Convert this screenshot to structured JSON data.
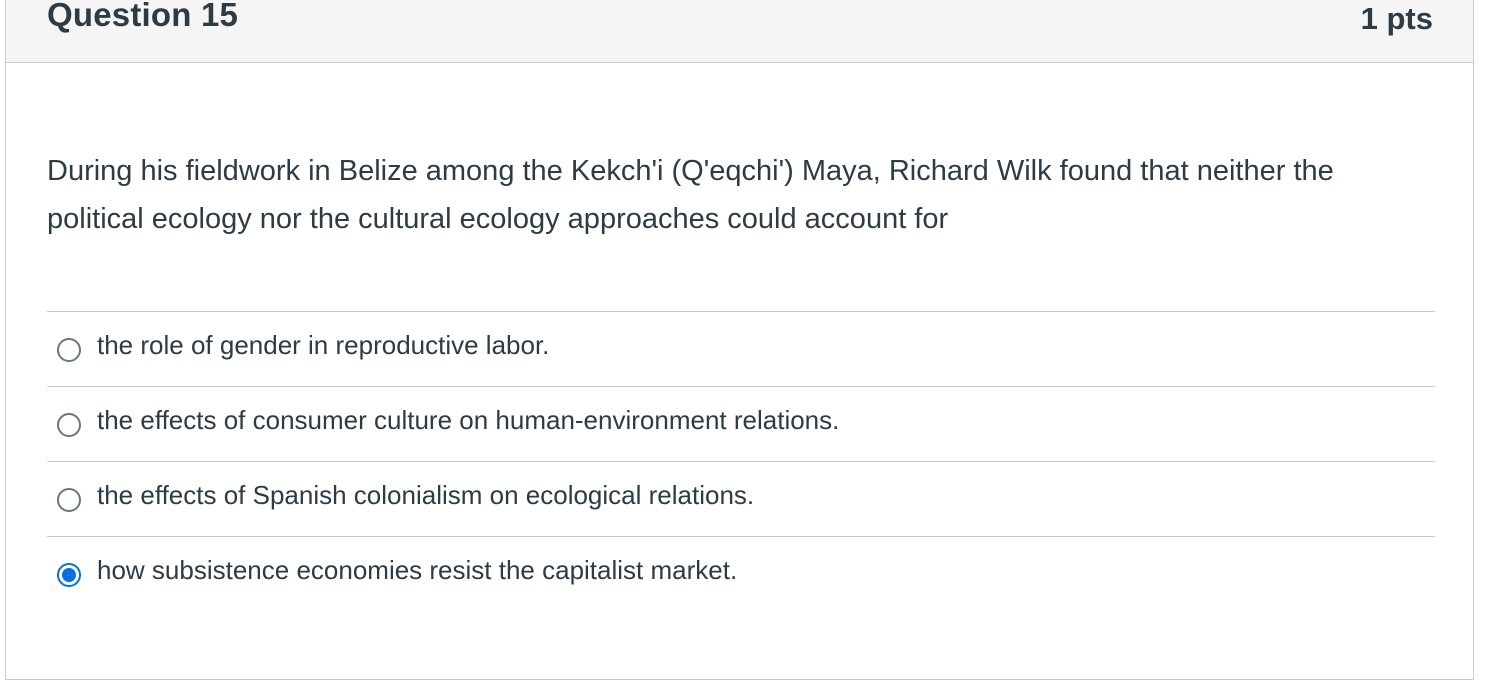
{
  "question": {
    "title": "Question 15",
    "points": "1 pts",
    "text": "During his fieldwork in Belize among the Kekch'i (Q'eqchi') Maya, Richard Wilk found that neither the political ecology nor the cultural ecology approaches could account for"
  },
  "answers": [
    {
      "label": "the role of gender in reproductive labor.",
      "selected": false
    },
    {
      "label": "the effects of consumer culture on human-environment relations.",
      "selected": false
    },
    {
      "label": "the effects of Spanish colonialism on ecological relations.",
      "selected": false
    },
    {
      "label": "how subsistence economies resist the capitalist market.",
      "selected": true
    }
  ],
  "colors": {
    "accent": "#0770e0",
    "text": "#2d3b45",
    "header_bg": "#f5f5f5",
    "border": "#c7cdd1"
  }
}
